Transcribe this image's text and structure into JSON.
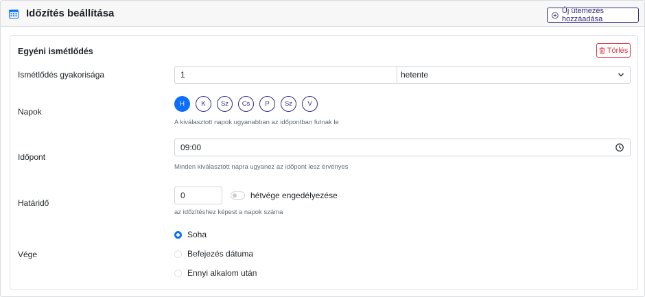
{
  "header": {
    "title": "Időzítés beállítása",
    "add_button_label": "Új ütemezés hozzáadása"
  },
  "card": {
    "title": "Egyéni ismétlődés",
    "delete_label": "Törlés",
    "frequency": {
      "label": "Ismétlődés gyakorisága",
      "value": "1",
      "unit": "hetente"
    },
    "days": {
      "label": "Napok",
      "items": [
        {
          "label": "H",
          "active": true
        },
        {
          "label": "K",
          "active": false
        },
        {
          "label": "Sz",
          "active": false
        },
        {
          "label": "Cs",
          "active": false
        },
        {
          "label": "P",
          "active": false
        },
        {
          "label": "Sz",
          "active": false
        },
        {
          "label": "V",
          "active": false
        }
      ],
      "hint": "A kiválasztott napok ugyanabban az időpontban futnak le"
    },
    "time": {
      "label": "Időpont",
      "value": "09:00",
      "hint": "Minden kiválasztott napra ugyanez az időpont lesz érvényes"
    },
    "deadline": {
      "label": "Határidő",
      "value": "0",
      "toggle_label": "hétvége engedélyezése",
      "toggle_on": false,
      "hint": "az időzítéshez képest a napok száma"
    },
    "end": {
      "label": "Vége",
      "options": [
        {
          "label": "Soha",
          "checked": true
        },
        {
          "label": "Befejezés dátuma",
          "checked": false
        },
        {
          "label": "Ennyi alkalom után",
          "checked": false
        }
      ]
    }
  },
  "colors": {
    "accent": "#0d6efd",
    "brand": "#2e2a7e",
    "danger": "#dc3545"
  }
}
